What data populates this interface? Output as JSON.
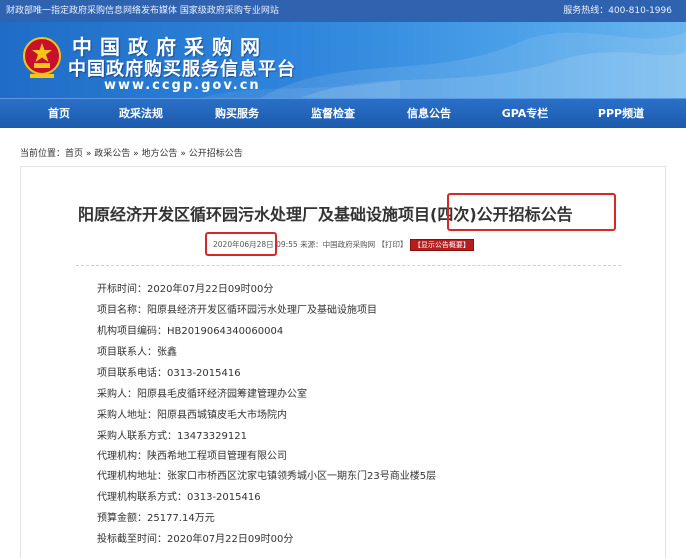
{
  "topbar": {
    "left_text": "财政部唯一指定政府采购信息网络发布媒体 国家级政府采购专业网站",
    "right_text": "服务热线：400-810-1996"
  },
  "header": {
    "line1": "中国政府采购网",
    "line2": "中国政府购买服务信息平台",
    "url": "www.ccgp.gov.cn"
  },
  "nav": [
    {
      "label": "首页"
    },
    {
      "label": "政采法规"
    },
    {
      "label": "购买服务"
    },
    {
      "label": "监督检查"
    },
    {
      "label": "信息公告"
    },
    {
      "label": "GPA专栏"
    },
    {
      "label": "PPP频道"
    }
  ],
  "breadcrumb": {
    "prefix": "当前位置：",
    "items": [
      "首页",
      "政采公告",
      "地方公告",
      "公开招标公告"
    ],
    "sep": " » "
  },
  "article": {
    "title": "阳原经济开发区循环园污水处理厂及基础设施项目(四次)公开招标公告",
    "date": "2020年06月28日",
    "time": " 09:55 ",
    "source": "来源：中国政府采购网 【打印】",
    "summary_button": "【显示公告概要】",
    "fields": [
      "开标时间：2020年07月22日09时00分",
      "项目名称：阳原县经济开发区循环园污水处理厂及基础设施项目",
      "机构项目编码：HB2019064340060004",
      "项目联系人：张鑫",
      "项目联系电话：0313-2015416",
      "采购人：阳原县毛皮循环经济园筹建管理办公室",
      "采购人地址：阳原县西城镇皮毛大市场院内",
      "采购人联系方式：13473329121",
      "代理机构：陕西希地工程项目管理有限公司",
      "代理机构地址：张家口市桥西区沈家屯镇领秀城小区一期东门23号商业楼5层",
      "代理机构联系方式：0313-2015416",
      "预算金额：25177.14万元",
      "投标截至时间：2020年07月22日09时00分"
    ]
  },
  "colors": {
    "topbar": "#2f63b0",
    "nav": "#1c5aac",
    "highlight": "#d62828"
  }
}
